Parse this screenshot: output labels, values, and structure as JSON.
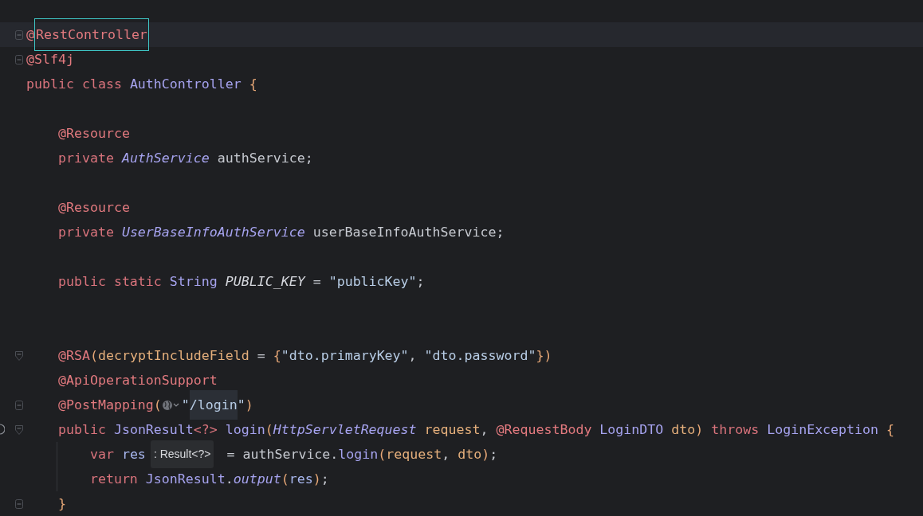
{
  "editor": {
    "lines": [
      {
        "current": true,
        "fold": {
          "kind": "box"
        },
        "tokens": [
          {
            "kind": "annotation",
            "text": "@"
          },
          {
            "kind": "annotation_outlined",
            "text": "RestController"
          }
        ]
      },
      {
        "current": false,
        "fold": {
          "kind": "box"
        },
        "tokens": [
          {
            "kind": "annotation",
            "text": "@Slf4j"
          }
        ]
      },
      {
        "current": false,
        "tokens": [
          {
            "kind": "keyword",
            "text": "public class "
          },
          {
            "kind": "type",
            "text": "AuthController "
          },
          {
            "kind": "bracket",
            "text": "{"
          }
        ]
      },
      {
        "current": false
      },
      {
        "current": false,
        "tokens": [
          {
            "kind": "annotation",
            "text": "    @Resource"
          }
        ]
      },
      {
        "current": false,
        "tokens": [
          {
            "kind": "keyword",
            "text": "    private "
          },
          {
            "kind": "type_italic",
            "text": "AuthService"
          },
          {
            "kind": "plain",
            "text": " authService;"
          }
        ]
      },
      {
        "current": false
      },
      {
        "current": false,
        "tokens": [
          {
            "kind": "annotation",
            "text": "    @Resource"
          }
        ]
      },
      {
        "current": false,
        "tokens": [
          {
            "kind": "keyword",
            "text": "    private "
          },
          {
            "kind": "type_italic",
            "text": "UserBaseInfoAuthService"
          },
          {
            "kind": "plain",
            "text": " userBaseInfoAuthService;"
          }
        ]
      },
      {
        "current": false
      },
      {
        "current": false,
        "tokens": [
          {
            "kind": "keyword",
            "text": "    public static "
          },
          {
            "kind": "type",
            "text": "String "
          },
          {
            "kind": "constant",
            "text": "PUBLIC_KEY"
          },
          {
            "kind": "plain",
            "text": " = "
          },
          {
            "kind": "string",
            "text": "\"publicKey\""
          },
          {
            "kind": "plain",
            "text": ";"
          }
        ]
      },
      {
        "current": false
      },
      {
        "current": false
      },
      {
        "current": false,
        "fold": {
          "kind": "arrow"
        },
        "tokens": [
          {
            "kind": "annotation",
            "text": "    @RSA"
          },
          {
            "kind": "bracket",
            "text": "("
          },
          {
            "kind": "param",
            "text": "decryptIncludeField"
          },
          {
            "kind": "plain",
            "text": " = "
          },
          {
            "kind": "bracket",
            "text": "{"
          },
          {
            "kind": "string",
            "text": "\"dto.primaryKey\""
          },
          {
            "kind": "plain",
            "text": ", "
          },
          {
            "kind": "string",
            "text": "\"dto.password\""
          },
          {
            "kind": "bracket",
            "text": "})"
          }
        ]
      },
      {
        "current": false,
        "tokens": [
          {
            "kind": "annotation",
            "text": "    @ApiOperationSupport"
          }
        ]
      },
      {
        "current": false,
        "fold": {
          "kind": "box"
        },
        "tokens": [
          {
            "kind": "annotation",
            "text": "    @PostMapping"
          },
          {
            "kind": "bracket",
            "text": "("
          },
          {
            "kind": "globe_icon"
          },
          {
            "kind": "string",
            "text": "\""
          },
          {
            "kind": "string_highlighted",
            "text": "/login"
          },
          {
            "kind": "string",
            "text": "\""
          },
          {
            "kind": "bracket",
            "text": ")"
          }
        ]
      },
      {
        "current": false,
        "fold": {
          "kind": "arrow"
        },
        "gutter_marker": true,
        "tokens": [
          {
            "kind": "keyword",
            "text": "    public "
          },
          {
            "kind": "type",
            "text": "JsonResult"
          },
          {
            "kind": "keyword",
            "text": "<?> "
          },
          {
            "kind": "method",
            "text": "login"
          },
          {
            "kind": "bracket",
            "text": "("
          },
          {
            "kind": "type_italic",
            "text": "HttpServletRequest "
          },
          {
            "kind": "param",
            "text": "request"
          },
          {
            "kind": "plain",
            "text": ", "
          },
          {
            "kind": "annotation",
            "text": "@RequestBody "
          },
          {
            "kind": "type",
            "text": "LoginDTO "
          },
          {
            "kind": "param",
            "text": "dto"
          },
          {
            "kind": "bracket",
            "text": ") "
          },
          {
            "kind": "keyword",
            "text": "throws "
          },
          {
            "kind": "type",
            "text": "LoginException "
          },
          {
            "kind": "bracket",
            "text": "{"
          }
        ]
      },
      {
        "current": false,
        "tokens": [
          {
            "kind": "keyword",
            "text": "        var "
          },
          {
            "kind": "variable",
            "text": "res"
          },
          {
            "kind": "inlay_hint",
            "text": ": Result<?>"
          },
          {
            "kind": "plain",
            "text": " = authService."
          },
          {
            "kind": "method",
            "text": "login"
          },
          {
            "kind": "bracket",
            "text": "("
          },
          {
            "kind": "param",
            "text": "request"
          },
          {
            "kind": "plain",
            "text": ", "
          },
          {
            "kind": "param",
            "text": "dto"
          },
          {
            "kind": "bracket",
            "text": ")"
          },
          {
            "kind": "plain",
            "text": ";"
          }
        ]
      },
      {
        "current": false,
        "tokens": [
          {
            "kind": "keyword",
            "text": "        return "
          },
          {
            "kind": "type",
            "text": "JsonResult"
          },
          {
            "kind": "plain",
            "text": "."
          },
          {
            "kind": "method_italic",
            "text": "output"
          },
          {
            "kind": "bracket",
            "text": "("
          },
          {
            "kind": "variable",
            "text": "res"
          },
          {
            "kind": "bracket",
            "text": ")"
          },
          {
            "kind": "plain",
            "text": ";"
          }
        ]
      },
      {
        "current": false,
        "fold": {
          "kind": "box"
        },
        "tokens": [
          {
            "kind": "bracket",
            "text": "    }"
          }
        ]
      }
    ]
  }
}
